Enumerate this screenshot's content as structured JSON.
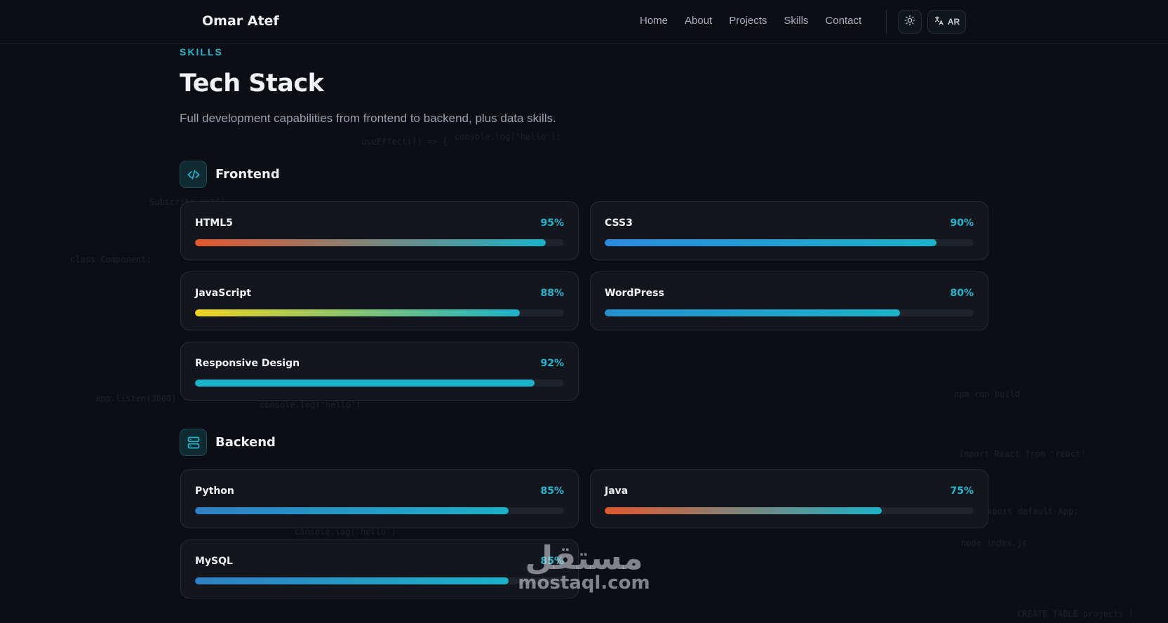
{
  "header": {
    "brand": "Omar Atef",
    "nav": [
      "Home",
      "About",
      "Projects",
      "Skills",
      "Contact"
    ],
    "theme_icon": "sun-icon",
    "lang_icon": "translate-icon",
    "lang_label": "AR"
  },
  "section": {
    "eyebrow": "SKILLS",
    "title": "Tech Stack",
    "subtitle": "Full development capabilities from frontend to backend, plus data skills."
  },
  "categories": [
    {
      "label": "Frontend",
      "icon": "code-icon",
      "skills": [
        {
          "name": "HTML5",
          "percent_label": "95%",
          "level": 95,
          "gradient": [
            "#e4572e",
            "#1ab3c9"
          ]
        },
        {
          "name": "CSS3",
          "percent_label": "90%",
          "level": 90,
          "gradient": [
            "#2b8be0",
            "#1ab3c9"
          ]
        },
        {
          "name": "JavaScript",
          "percent_label": "88%",
          "level": 88,
          "gradient": [
            "#f0d41c",
            "#1ab3c9"
          ]
        },
        {
          "name": "WordPress",
          "percent_label": "80%",
          "level": 80,
          "gradient": [
            "#2591cf",
            "#1ab3c9"
          ]
        },
        {
          "name": "Responsive Design",
          "percent_label": "92%",
          "level": 92,
          "gradient": [
            "#1ab3c9",
            "#1ab3c9"
          ]
        }
      ]
    },
    {
      "label": "Backend",
      "icon": "server-icon",
      "skills": [
        {
          "name": "Python",
          "percent_label": "85%",
          "level": 85,
          "gradient": [
            "#2f80c4",
            "#1ab3c9"
          ]
        },
        {
          "name": "Java",
          "percent_label": "75%",
          "level": 75,
          "gradient": [
            "#e4572e",
            "#1ab3c9"
          ]
        },
        {
          "name": "MySQL",
          "percent_label": "85%",
          "level": 85,
          "gradient": [
            "#2f80c4",
            "#1ab3c9"
          ]
        }
      ]
    }
  ],
  "watermark": {
    "arabic": "مستقل",
    "latin": "mostaql.com"
  },
  "colors": {
    "accent": "#22b8cf",
    "background": "#0b0e14",
    "card": "#13161d"
  }
}
